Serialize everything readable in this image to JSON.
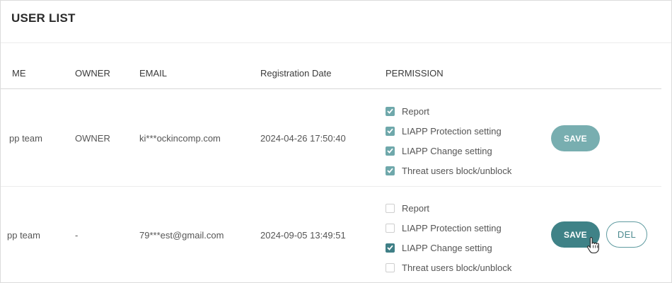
{
  "title": "USER LIST",
  "columns": {
    "name": "ME",
    "owner": "OWNER",
    "email": "EMAIL",
    "registration_date": "Registration Date",
    "permission": "PERMISSION"
  },
  "rows": [
    {
      "name": "pp team",
      "owner": "OWNER",
      "email": "ki***ockincomp.com",
      "registration_date": "2024-04-26 17:50:40",
      "permissions": [
        {
          "label": "Report",
          "checked": true
        },
        {
          "label": "LIAPP Protection setting",
          "checked": true
        },
        {
          "label": "LIAPP Change setting",
          "checked": true
        },
        {
          "label": "Threat users block/unblock",
          "checked": true
        }
      ],
      "save_label": "SAVE"
    },
    {
      "name": "pp team",
      "owner": "-",
      "email": "79***est@gmail.com",
      "registration_date": "2024-09-05 13:49:51",
      "permissions": [
        {
          "label": "Report",
          "checked": false
        },
        {
          "label": "LIAPP Protection setting",
          "checked": false
        },
        {
          "label": "LIAPP Change setting",
          "checked": true
        },
        {
          "label": "Threat users block/unblock",
          "checked": false
        }
      ],
      "save_label": "SAVE",
      "delete_label": "DEL"
    }
  ],
  "colors": {
    "accent": "#3f8287",
    "accent_light": "#78aeb0",
    "checkbox_checked_light": "#6fa8ab"
  },
  "icons": {
    "checkbox": "check-icon",
    "cursor": "hand-pointer-icon"
  }
}
